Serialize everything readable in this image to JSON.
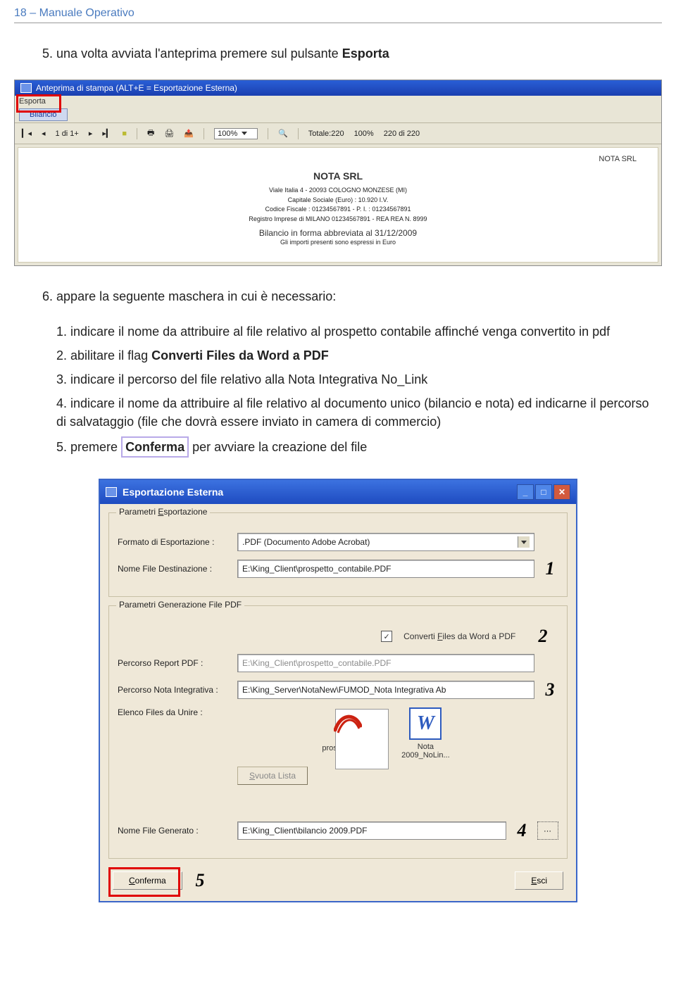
{
  "header": {
    "page_num": "18",
    "sep": "–",
    "title": "Manuale Operativo"
  },
  "step5": {
    "num": "5.",
    "text_a": "una volta avviata l'anteprima premere sul pulsante ",
    "bold": "Esporta"
  },
  "shot1": {
    "title": "Anteprima di stampa (ALT+E = Esportazione Esterna)",
    "menu": "Esporta",
    "tab": "Bilancio",
    "nav_text": "1 di 1+",
    "zoom": "100%",
    "totale": "Totale:220",
    "pct": "100%",
    "range": "220 di 220",
    "doc": {
      "right": "NOTA SRL",
      "h1": "NOTA SRL",
      "l1": "Viale Italia 4 - 20093  COLOGNO MONZESE (MI)",
      "l2": "Capitale Sociale (Euro) : 10.920  I.V.",
      "l3": "Codice Fiscale : 01234567891 - P. I. : 01234567891",
      "l4": "Registro Imprese di MILANO 01234567891 - REA REA N. 8999",
      "l5": "Bilancio in forma abbreviata al 31/12/2009",
      "l6": "Gli importi presenti sono espressi in Euro"
    }
  },
  "step6": {
    "num": "6.",
    "text": "appare la seguente maschera in cui è necessario:"
  },
  "sub": {
    "s1": {
      "n": "1.",
      "a": "indicare il nome da attribuire al file relativo al prospetto contabile affinché venga convertito in pdf"
    },
    "s2": {
      "n": "2.",
      "a": "abilitare il flag ",
      "b": "Converti Files da Word a PDF"
    },
    "s3": {
      "n": "3.",
      "a": "indicare il percorso del file relativo alla Nota Integrativa No_Link"
    },
    "s4": {
      "n": "4.",
      "a": "indicare il nome da attribuire al file relativo al documento unico (bilancio e nota) ed indicarne il percorso di salvataggio (file che dovrà essere inviato in camera di commercio)"
    },
    "s5": {
      "n": "5.",
      "a": "premere ",
      "b": "Conferma",
      "c": " per avviare la creazione del file"
    }
  },
  "dlg": {
    "title": "Esportazione Esterna",
    "fs1": "Parametri Esportazione",
    "fs2": "Parametri Generazione  File PDF",
    "lbl_formato": "Formato di Esportazione :",
    "val_formato": ".PDF (Documento Adobe Acrobat)",
    "lbl_nome": "Nome File Destinazione :",
    "val_nome": "E:\\King_Client\\prospetto_contabile.PDF",
    "chk_label": "Converti Files da Word a PDF",
    "lbl_report": "Percorso Report PDF :",
    "val_report": "E:\\King_Client\\prospetto_contabile.PDF",
    "lbl_nota": "Percorso Nota Integrativa :",
    "val_nota": "E:\\King_Server\\NotaNew\\FUMOD_Nota Integrativa Ab",
    "lbl_elenco": "Elenco Files da Unire :",
    "btn_svuota": "Svuota Lista",
    "file1": "prospetto_co...",
    "file2_a": "Nota",
    "file2_b": "2009_NoLin...",
    "lbl_gen": "Nome File Generato :",
    "val_gen": "E:\\King_Client\\bilancio 2009.PDF",
    "btn_conf": "Conferma",
    "btn_conf_u": "C",
    "btn_conf_rest": "onferma",
    "btn_esci_u": "E",
    "btn_esci_rest": "sci",
    "n1": "1",
    "n2": "2",
    "n3": "3",
    "n4": "4",
    "n5": "5"
  }
}
